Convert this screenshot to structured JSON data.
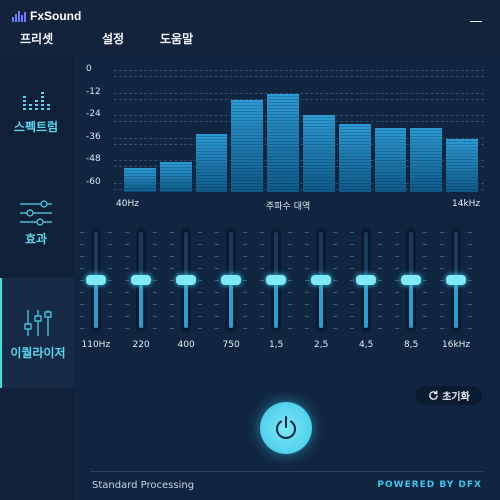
{
  "app": {
    "name": "FxSound"
  },
  "menu": [
    {
      "label": "프리셋"
    },
    {
      "label": "설정"
    },
    {
      "label": "도움말"
    }
  ],
  "sidebar": [
    {
      "label": "스펙트럼",
      "icon": "spectrum-icon"
    },
    {
      "label": "효과",
      "icon": "sliders-icon"
    },
    {
      "label": "이퀄라이저",
      "icon": "equalizer-icon",
      "active": true
    }
  ],
  "chart_data": {
    "type": "bar",
    "xlabel": "주파수 대역",
    "x_range_labels": [
      "40Hz",
      "14kHz"
    ],
    "ylim": [
      -65,
      0
    ],
    "yticks": [
      "0",
      "-12",
      "-24",
      "-36",
      "-48",
      "-60"
    ],
    "values": [
      -52,
      -49,
      -34,
      -16,
      -13,
      -24,
      -29,
      -31,
      -31,
      -37
    ]
  },
  "equalizer": {
    "bands": [
      "110Hz",
      "220",
      "400",
      "750",
      "1,5",
      "2,5",
      "4,5",
      "8,5",
      "16kHz"
    ],
    "levels": [
      0,
      0,
      0,
      0,
      0,
      0,
      0,
      0,
      0
    ]
  },
  "reset_label": "초기화",
  "status": "Standard Processing",
  "powered_by": "POWERED BY DFX",
  "colors": {
    "accent": "#3fd0f0",
    "background": "#0f1e33"
  }
}
